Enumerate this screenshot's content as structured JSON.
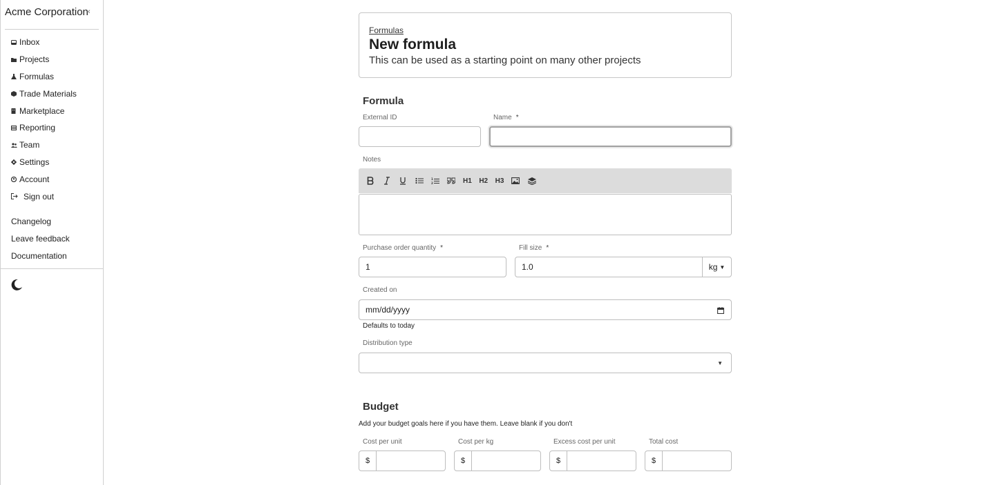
{
  "sidebar": {
    "brand": "Acme Corporation",
    "collapse_icon": "chevron-left-icon",
    "items": [
      {
        "label": "Inbox",
        "icon": "inbox-icon"
      },
      {
        "label": "Projects",
        "icon": "folder-icon"
      },
      {
        "label": "Formulas",
        "icon": "flask-icon"
      },
      {
        "label": "Trade Materials",
        "icon": "cube-icon"
      },
      {
        "label": "Marketplace",
        "icon": "building-icon"
      },
      {
        "label": "Reporting",
        "icon": "table-icon"
      },
      {
        "label": "Team",
        "icon": "users-icon"
      },
      {
        "label": "Settings",
        "icon": "gear-icon"
      },
      {
        "label": "Account",
        "icon": "user-circle-icon"
      },
      {
        "label": "Sign out",
        "icon": "sign-out-icon"
      }
    ],
    "links": [
      "Changelog",
      "Leave feedback",
      "Documentation"
    ],
    "theme_icon": "moon-icon"
  },
  "header": {
    "breadcrumb": "Formulas",
    "title": "New formula",
    "subtitle": "This can be used as a starting point on many other projects"
  },
  "formula": {
    "section_title": "Formula",
    "external_id_label": "External ID",
    "external_id_value": "",
    "name_label": "Name",
    "name_value": "",
    "required_mark": "*",
    "notes_label": "Notes",
    "toolbar": [
      {
        "name": "bold",
        "label": "B"
      },
      {
        "name": "italic",
        "label": "I"
      },
      {
        "name": "underline",
        "label": "U"
      },
      {
        "name": "bullet-list",
        "label": ""
      },
      {
        "name": "ordered-list",
        "label": ""
      },
      {
        "name": "blockquote",
        "label": ""
      },
      {
        "name": "h1",
        "label": "H1"
      },
      {
        "name": "h2",
        "label": "H2"
      },
      {
        "name": "h3",
        "label": "H3"
      },
      {
        "name": "image",
        "label": ""
      },
      {
        "name": "layers",
        "label": ""
      }
    ],
    "po_qty_label": "Purchase order quantity",
    "po_qty_value": "1",
    "fill_size_label": "Fill size",
    "fill_size_value": "1.0",
    "fill_unit": "kg",
    "created_on_label": "Created on",
    "created_on_placeholder": "mm/dd/yyyy",
    "created_on_hint": "Defaults to today",
    "distribution_label": "Distribution type",
    "distribution_value": ""
  },
  "budget": {
    "section_title": "Budget",
    "description": "Add your budget goals here if you have them. Leave blank if you don't",
    "currency_symbol": "$",
    "fields": [
      {
        "label": "Cost per unit",
        "value": ""
      },
      {
        "label": "Cost per kg",
        "value": ""
      },
      {
        "label": "Excess cost per unit",
        "value": ""
      },
      {
        "label": "Total cost",
        "value": ""
      }
    ]
  }
}
